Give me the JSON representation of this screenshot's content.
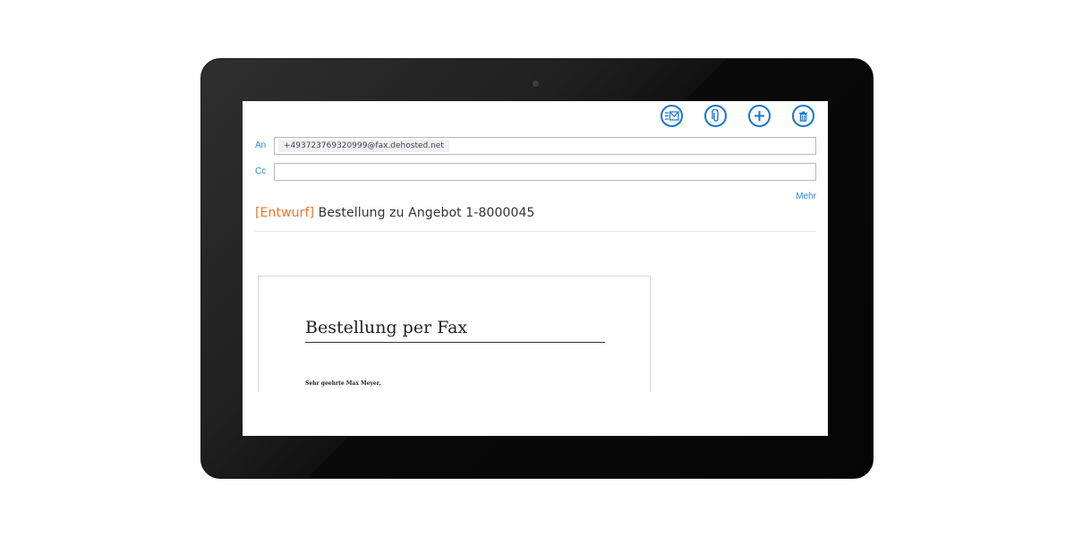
{
  "toolbar": {
    "send_icon": "send-mail-icon",
    "attach_icon": "paperclip-icon",
    "add_icon": "plus-icon",
    "delete_icon": "trash-icon"
  },
  "recipients": {
    "to_label": "An",
    "to_value": "+493723769320999@fax.dehosted.net",
    "cc_label": "Cc",
    "cc_value": "",
    "more_label": "Mehr"
  },
  "subject": {
    "draft_tag": "[Entwurf]",
    "text": "Bestellung zu Angebot 1-8000045"
  },
  "document": {
    "title": "Bestellung per Fax",
    "greeting": "Sehr geehrte Max Meyer,"
  },
  "colors": {
    "accent": "#1976d2",
    "draft": "#e8762a",
    "label": "#2b8ad6"
  }
}
